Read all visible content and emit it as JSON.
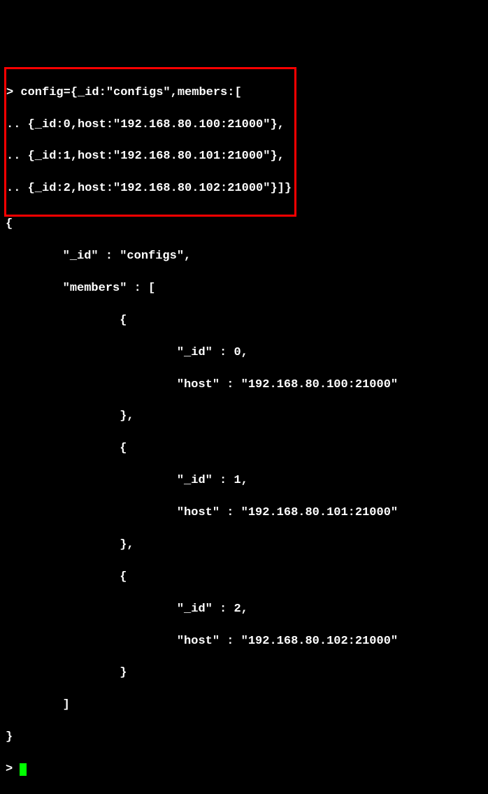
{
  "input": {
    "line1": "> config={_id:\"configs\",members:[",
    "line2": ".. {_id:0,host:\"192.168.80.100:21000\"},",
    "line3": ".. {_id:1,host:\"192.168.80.101:21000\"},",
    "line4": ".. {_id:2,host:\"192.168.80.102:21000\"}]}"
  },
  "output": {
    "l1": "{",
    "l2": "        \"_id\" : \"configs\",",
    "l3": "        \"members\" : [",
    "l4": "                {",
    "l5": "                        \"_id\" : 0,",
    "l6": "                        \"host\" : \"192.168.80.100:21000\"",
    "l7": "                },",
    "l8": "                {",
    "l9": "                        \"_id\" : 1,",
    "l10": "                        \"host\" : \"192.168.80.101:21000\"",
    "l11": "                },",
    "l12": "                {",
    "l13": "                        \"_id\" : 2,",
    "l14": "                        \"host\" : \"192.168.80.102:21000\"",
    "l15": "                }",
    "l16": "        ]",
    "l17": "}",
    "prompt": "> "
  }
}
